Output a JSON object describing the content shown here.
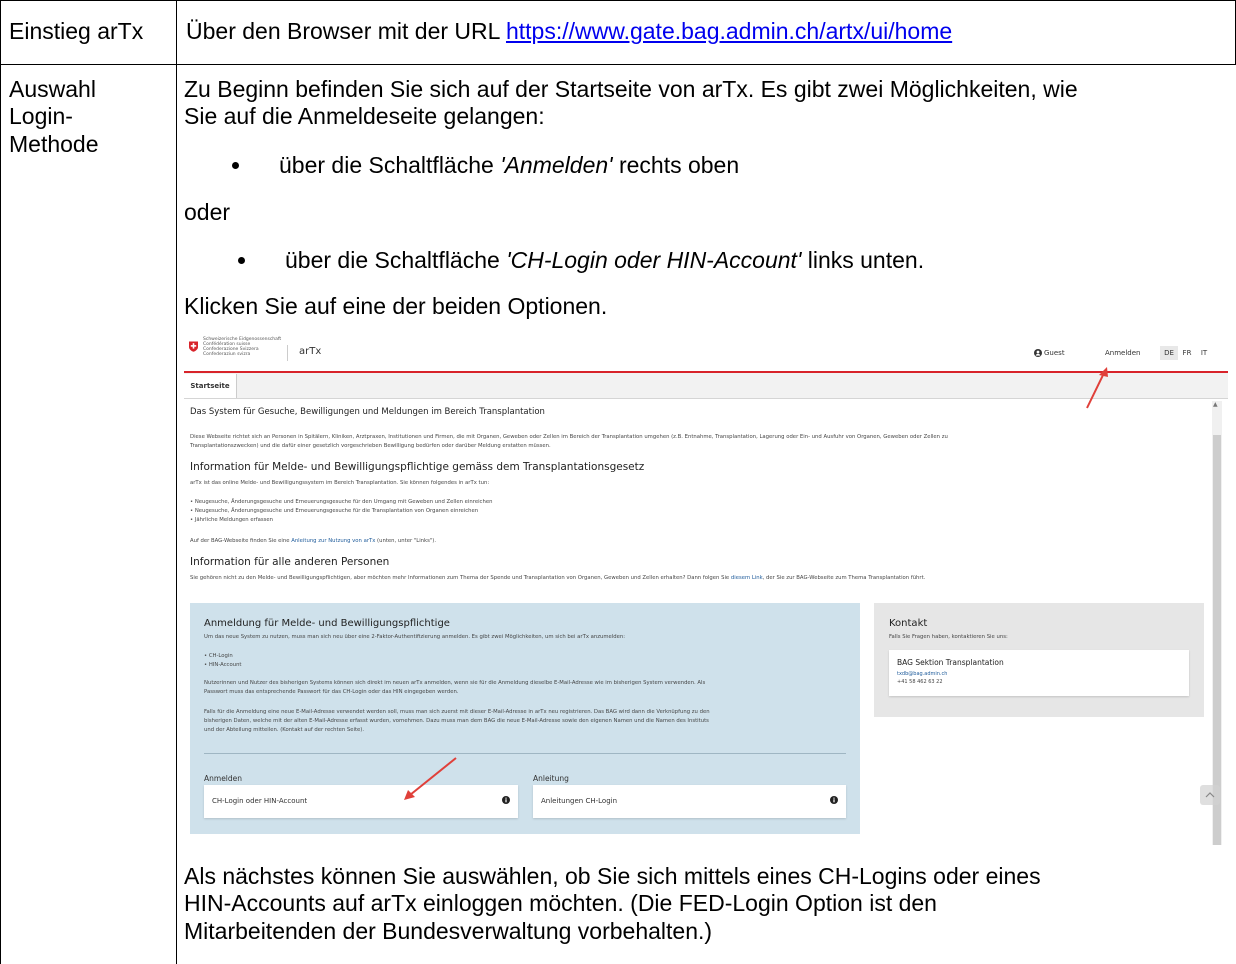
{
  "table": {
    "row1": {
      "label": "Einstieg arTx",
      "text_prefix": "Über den Browser mit der URL ",
      "url": "https://www.gate.bag.admin.ch/artx/ui/home"
    },
    "row2": {
      "label_lines": [
        "Auswahl",
        "Login-",
        "Methode"
      ],
      "intro_lines": [
        "Zu Beginn befinden Sie sich auf der Startseite von arTx. Es gibt zwei Möglichkeiten, wie",
        "Sie auf die Anmeldeseite gelangen:"
      ],
      "bullet1": {
        "pre": "über die Schaltfläche ",
        "em": "'Anmelden'",
        "post": " rechts oben"
      },
      "or_text": "oder",
      "bullet2": {
        "pre": "über die Schaltfläche ",
        "em": "'CH-Login oder HIN-Account'",
        "post": " links unten."
      },
      "click_text": "Klicken Sie auf eine der beiden Optionen.",
      "after_lines": [
        "Als nächstes können Sie auswählen, ob Sie sich mittels eines CH-Logins oder eines",
        "HIN-Accounts auf arTx einloggen möchten. (Die FED-Login Option ist den",
        "Mitarbeitenden der Bundesverwaltung vorbehalten.)"
      ]
    }
  },
  "screenshot": {
    "confed_lines": [
      "Schweizerische Eidgenossenschaft",
      "Confédération suisse",
      "Confederazione Svizzera",
      "Confederaziun svizra"
    ],
    "app_name": "arTx",
    "guest_label": "Guest",
    "login_label": "Anmelden",
    "languages": [
      "DE",
      "FR",
      "IT"
    ],
    "active_language": "DE",
    "tab_label": "Startseite",
    "page_heading": "Das System für Gesuche, Bewilligungen und Meldungen im Bereich Transplantation",
    "intro_lines": [
      "Diese Webseite richtet sich an Personen in Spitälern, Kliniken, Arztpraxen, Institutionen und Firmen, die mit Organen, Geweben oder Zellen im Bereich der Transplantation umgehen (z.B. Entnahme, Transplantation, Lagerung oder Ein- und Ausfuhr von Organen, Geweben oder Zellen zu",
      "Transplantationszwecken) und die dafür einer gesetzlich vorgeschrieben Bewilligung bedürfen oder darüber Meldung erstatten müssen."
    ],
    "section1": {
      "heading": "Information für Melde- und Bewilligungspflichtige gemäss dem Transplantationsgesetz",
      "lead": "arTx ist das online Melde- und Bewilligungssystem im Bereich Transplantation. Sie können folgendes in arTx tun:",
      "items": [
        "Neugesuche, Änderungsgesuche und Erneuerungsgesuche für den Umgang mit Geweben und Zellen einreichen",
        "Neugesuche, Änderungsgesuche und Erneuerungsgesuche für die Transplantation von Organen einreichen",
        "Jährliche Meldungen erfassen"
      ],
      "guide_pre": "Auf der BAG-Webseite finden Sie eine ",
      "guide_link": "Anleitung zur Nutzung von arTx",
      "guide_post": " (unten, unter \"Links\")."
    },
    "section2": {
      "heading": "Information für alle anderen Personen",
      "text_pre": "Sie gehören nicht zu den Melde- und Bewilligungspflichtigen, aber möchten mehr Informationen zum Thema der Spende und Transplantation von Organen, Geweben und Zellen erhalten? Dann folgen Sie ",
      "text_link": "diesem Link",
      "text_post": ", der Sie zur BAG-Webseite zum Thema Transplantation führt."
    },
    "login_box": {
      "heading": "Anmeldung für Melde- und Bewilligungspflichtige",
      "lead": "Um das neue System zu nutzen, muss man sich neu über eine 2-Faktor-Authentifizierung anmelden. Es gibt zwei Möglichkeiten, um sich bei arTx anzumelden:",
      "options": [
        "CH-Login",
        "HIN-Account"
      ],
      "para1_lines": [
        "Nutzerinnen und Nutzer des bisherigen Systems können sich direkt im neuen arTx anmelden, wenn sie für die Anmeldung dieselbe E-Mail-Adresse wie im bisherigen System verwenden. Als",
        "Passwort muss das entsprechende Passwort für das CH-Login oder das HIN eingegeben werden."
      ],
      "para2_lines": [
        "Falls für die Anmeldung eine neue E-Mail-Adresse verwendet werden soll, muss man sich zuerst mit dieser E-Mail-Adresse in arTx neu registrieren. Das BAG wird dann die Verknüpfung zu den",
        "bisherigen Daten, welche mit der alten E-Mail-Adresse erfasst wurden, vornehmen. Dazu muss man dem BAG die neue E-Mail-Adresse sowie den eigenen Namen und die Namen des Instituts",
        "und der Abteilung mitteilen. (Kontakt auf der rechten Seite)."
      ],
      "login_col_label": "Anmelden",
      "login_button": "CH-Login oder HIN-Account",
      "guide_col_label": "Anleitung",
      "guide_button": "Anleitungen CH-Login"
    },
    "contact": {
      "heading": "Kontakt",
      "lead": "Falls Sie Fragen haben, kontaktieren Sie uns:",
      "org": "BAG Sektion Transplantation",
      "email": "txdb@bag.admin.ch",
      "phone": "+41 58 462 63 22"
    }
  },
  "colors": {
    "link": "#0000ee",
    "swiss_red": "#d8232a",
    "annotation_arrow": "#e0403a",
    "login_box_bg": "#cfe1eb",
    "contact_box_bg": "#e6e6e6"
  }
}
